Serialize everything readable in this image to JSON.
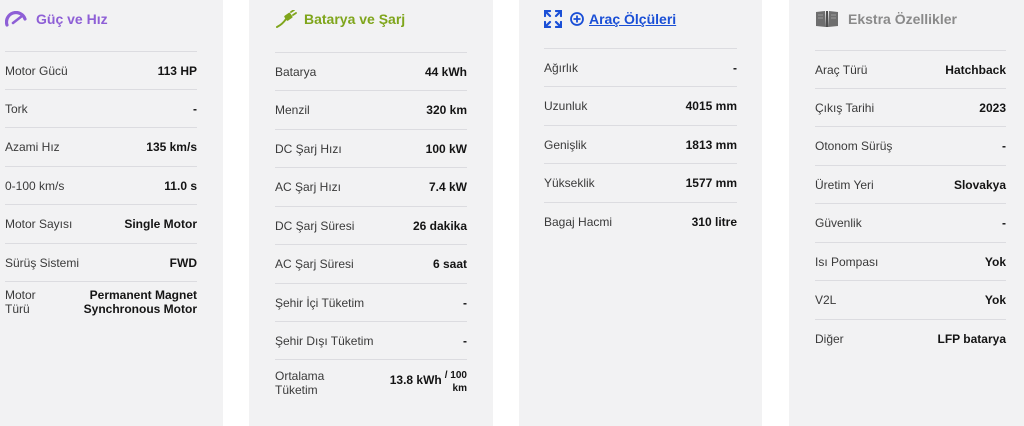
{
  "card1": {
    "title": "Güç ve Hız",
    "title_color": "#8e5fd6",
    "icon": "speedometer-icon",
    "rows": [
      {
        "label": "Motor Gücü",
        "value": "113 HP"
      },
      {
        "label": "Tork",
        "value": "-"
      },
      {
        "label": "Azami Hız",
        "value": "135 km/s"
      },
      {
        "label": "0-100 km/s",
        "value": "11.0 s"
      },
      {
        "label": "Motor Sayısı",
        "value": "Single Motor"
      },
      {
        "label": "Sürüş Sistemi",
        "value": "FWD"
      },
      {
        "label_l1": "Motor",
        "label_l2": "Türü",
        "value_l1": "Permanent Magnet",
        "value_l2": "Synchronous Motor"
      }
    ]
  },
  "card2": {
    "title": "Batarya ve Şarj",
    "title_color": "#7fa51b",
    "icon": "charging-plug-icon",
    "rows": [
      {
        "label": "Batarya",
        "value": "44 kWh"
      },
      {
        "label": "Menzil",
        "value": "320 km"
      },
      {
        "label": "DC Şarj Hızı",
        "value": "100 kW"
      },
      {
        "label": "AC Şarj Hızı",
        "value": "7.4 kW"
      },
      {
        "label": "DC Şarj Süresi",
        "value": "26 dakika"
      },
      {
        "label": "AC Şarj Süresi",
        "value": "6 saat"
      },
      {
        "label": "Şehir İçi Tüketim",
        "value": "-"
      },
      {
        "label": "Şehir Dışı Tüketim",
        "value": "-"
      },
      {
        "label_l1": "Ortalama",
        "label_l2": "Tüketim",
        "value_main": "13.8 kWh",
        "value_sup": "/ 100",
        "value_sub": "km"
      }
    ]
  },
  "card3": {
    "title": "Araç Ölçüleri",
    "title_color": "#1a4fd6",
    "icon": "expand-arrows-icon",
    "icon2": "plus-circle-icon",
    "rows": [
      {
        "label": "Ağırlık",
        "value": "-"
      },
      {
        "label": "Uzunluk",
        "value": "4015 mm"
      },
      {
        "label": "Genişlik",
        "value": "1813 mm"
      },
      {
        "label": "Yükseklik",
        "value": "1577 mm"
      },
      {
        "label": "Bagaj Hacmi",
        "value": "310 litre"
      }
    ]
  },
  "card4": {
    "title": "Ekstra Özellikler",
    "title_color": "#8a8a8a",
    "icon": "book-icon",
    "rows": [
      {
        "label": "Araç Türü",
        "value": "Hatchback"
      },
      {
        "label": "Çıkış Tarihi",
        "value": "2023"
      },
      {
        "label": "Otonom Sürüş",
        "value": "-"
      },
      {
        "label": "Üretim Yeri",
        "value": "Slovakya"
      },
      {
        "label": "Güvenlik",
        "value": "-"
      },
      {
        "label": "Isı Pompası",
        "value": "Yok"
      },
      {
        "label": "V2L",
        "value": "Yok"
      },
      {
        "label": "Diğer",
        "value": "LFP batarya"
      }
    ]
  }
}
